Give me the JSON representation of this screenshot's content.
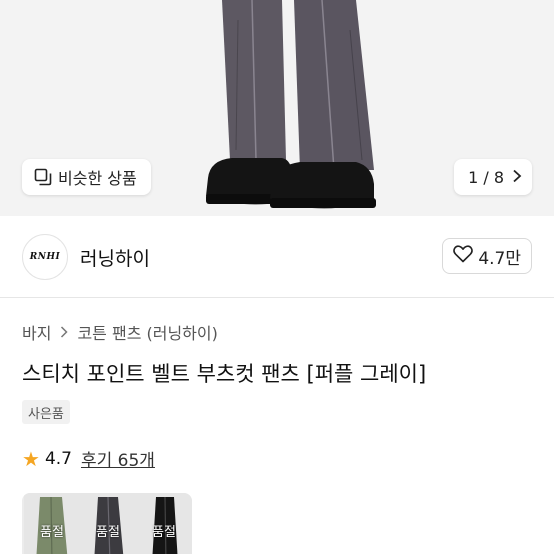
{
  "hero": {
    "similar_label": "비슷한 상품",
    "similar_icon": "similar-products-icon",
    "counter_text": "1 / 8",
    "counter_icon": "chevron-right-icon"
  },
  "brand": {
    "logo_text": "RNHI",
    "name": "러닝하이",
    "like_count": "4.7만",
    "like_icon": "heart-outline-icon"
  },
  "breadcrumb": {
    "items": [
      "바지",
      "코튼 팬츠 (러닝하이)"
    ],
    "separator_icon": "chevron-right-icon"
  },
  "product": {
    "title": "스티치 포인트 벨트 부츠컷 팬츠 [퍼플 그레이]",
    "badge": "사은품"
  },
  "rating": {
    "score": "4.7",
    "reviews": "후기 65개",
    "star_color": "#f5a623"
  },
  "options": [
    {
      "status": "품절",
      "color_hint": "olive-green"
    },
    {
      "status": "품절",
      "color_hint": "charcoal"
    },
    {
      "status": "품절",
      "color_hint": "black"
    }
  ]
}
